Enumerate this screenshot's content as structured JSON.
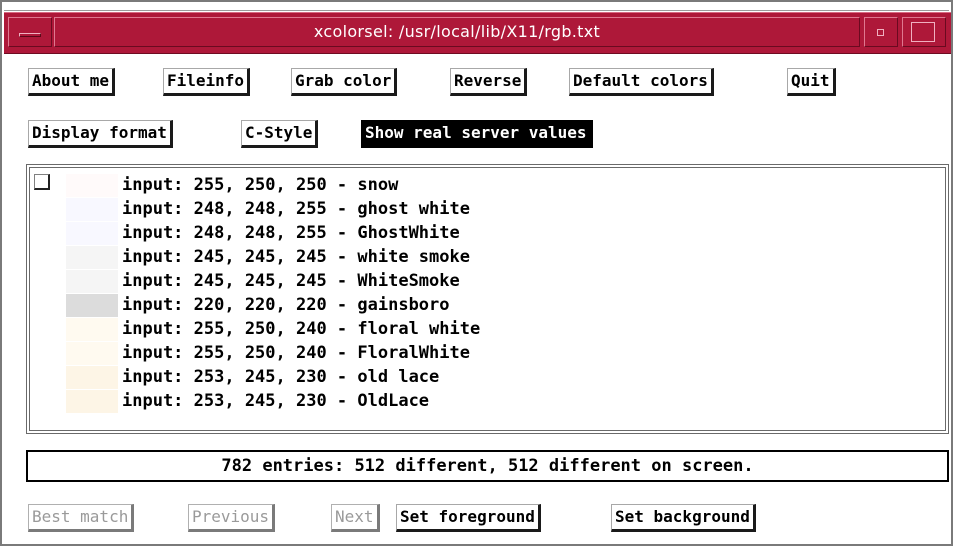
{
  "window": {
    "title": "xcolorsel: /usr/local/lib/X11/rgb.txt"
  },
  "toolbar1": [
    {
      "label": "About me"
    },
    {
      "label": "Fileinfo"
    },
    {
      "label": "Grab color"
    },
    {
      "label": "Reverse"
    },
    {
      "label": "Default colors"
    },
    {
      "label": "Quit"
    }
  ],
  "toolbar2": [
    {
      "label": "Display format"
    },
    {
      "label": "C-Style"
    },
    {
      "label": "Show real server values"
    }
  ],
  "list": [
    {
      "text": "input: 255, 250, 250 - snow",
      "color": "#fffafa"
    },
    {
      "text": "input: 248, 248, 255 - ghost white",
      "color": "#f8f8ff"
    },
    {
      "text": "input: 248, 248, 255 - GhostWhite",
      "color": "#f8f8ff"
    },
    {
      "text": "input: 245, 245, 245 - white smoke",
      "color": "#f5f5f5"
    },
    {
      "text": "input: 245, 245, 245 - WhiteSmoke",
      "color": "#f5f5f5"
    },
    {
      "text": "input: 220, 220, 220 - gainsboro",
      "color": "#dcdcdc"
    },
    {
      "text": "input: 255, 250, 240 - floral white",
      "color": "#fffaf0"
    },
    {
      "text": "input: 255, 250, 240 - FloralWhite",
      "color": "#fffaf0"
    },
    {
      "text": "input: 253, 245, 230 - old lace",
      "color": "#fdf5e6"
    },
    {
      "text": "input: 253, 245, 230 - OldLace",
      "color": "#fdf5e6"
    }
  ],
  "status": {
    "text": "782 entries: 512 different, 512 different on screen."
  },
  "bottom": [
    {
      "label": "Best match"
    },
    {
      "label": "Previous"
    },
    {
      "label": "Next"
    },
    {
      "label": "Set foreground"
    },
    {
      "label": "Set background"
    }
  ],
  "colors": {
    "titlebar": "#ae1839"
  }
}
